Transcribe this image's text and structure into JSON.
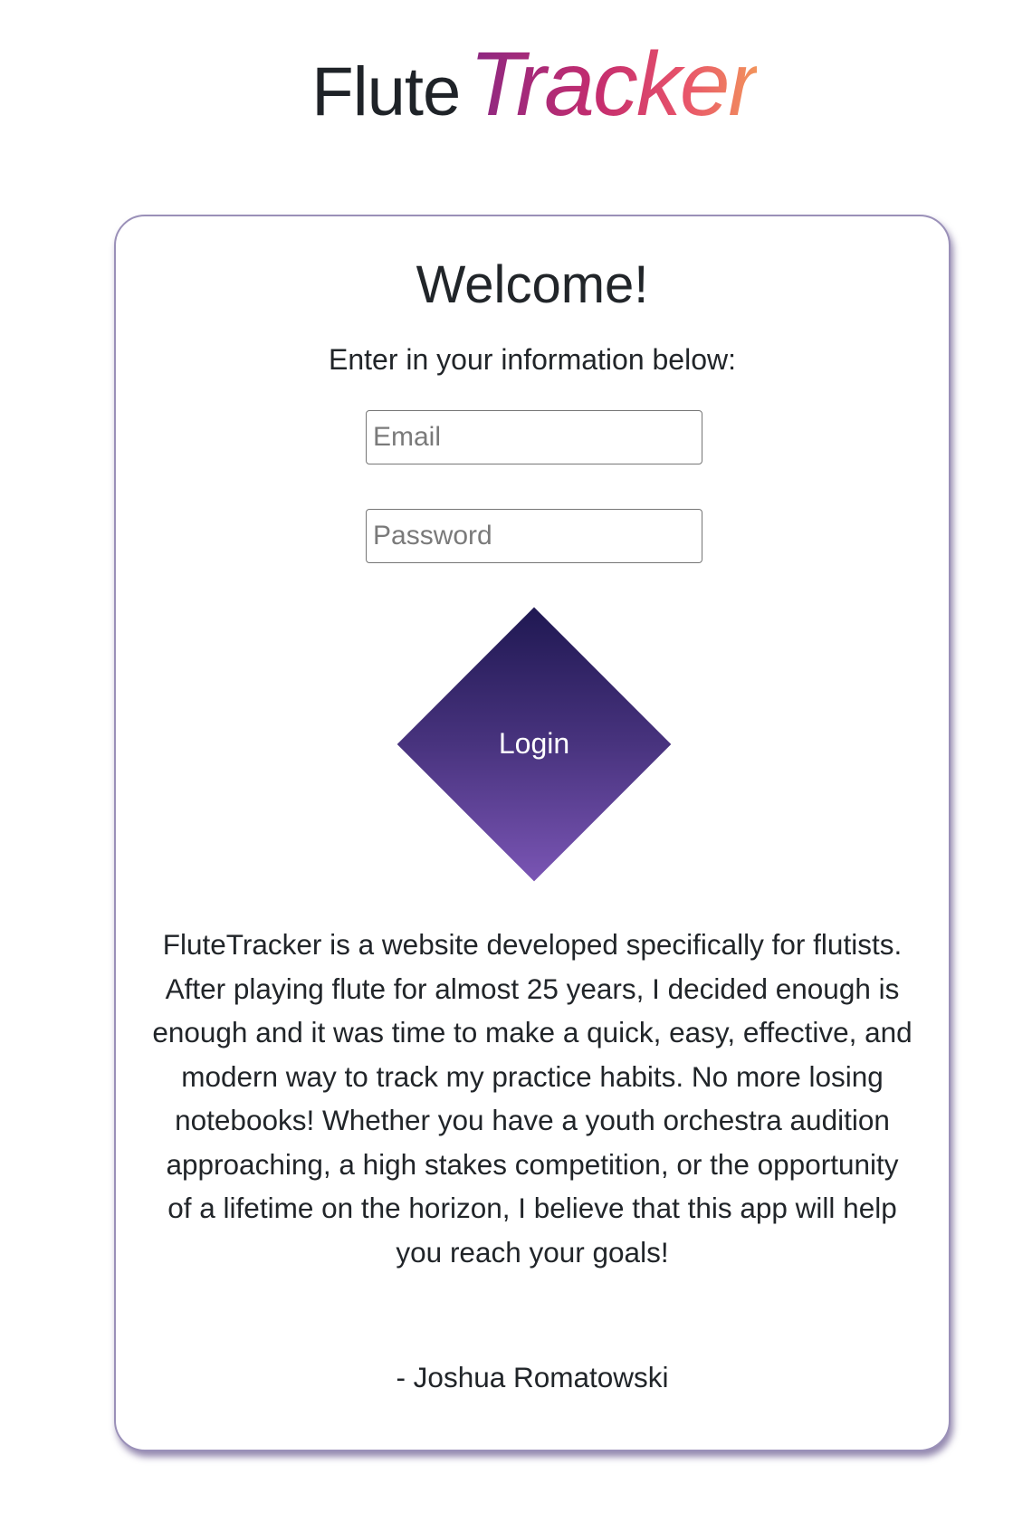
{
  "brand": {
    "part1": "Flute",
    "part2": "Tracker",
    "gradient_colors": [
      "#8b2882",
      "#c52d6e",
      "#e8546a",
      "#f2935c"
    ]
  },
  "card": {
    "title": "Welcome!",
    "subtitle": "Enter in your information below:",
    "email": {
      "placeholder": "Email",
      "value": ""
    },
    "password": {
      "placeholder": "Password",
      "value": ""
    },
    "login_label": "Login",
    "login_colors": [
      "#1f1852",
      "#7a55b4"
    ],
    "description": "FluteTracker is a website developed specifically for flutists. After playing flute for almost 25 years, I decided enough is enough and it was time to make a quick, easy, effective, and modern way to track my practice habits. No more losing notebooks! Whether you have a youth orchestra audition approaching, a high stakes competition, or the opportunity of a lifetime on the horizon, I believe that this app will help you reach your goals!",
    "author": "- Joshua Romatowski"
  }
}
